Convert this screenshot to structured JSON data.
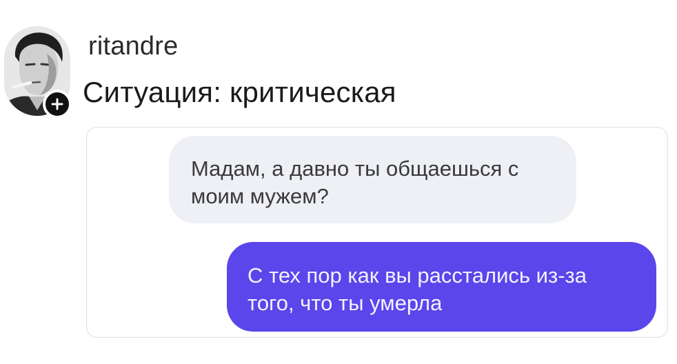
{
  "post": {
    "username": "ritandre",
    "caption": "Ситуация: критическая",
    "avatar_icon": "user-avatar-photo",
    "follow_icon": "plus-icon"
  },
  "chat": {
    "messages": [
      {
        "direction": "incoming",
        "text": "Мадам, а давно ты общаешься с моим мужем?",
        "bubble_color": "#eef0f5"
      },
      {
        "direction": "outgoing",
        "text": "С тех пор как вы расстались из-за того, что ты умерла",
        "bubble_color": "#5a46ea"
      }
    ]
  }
}
